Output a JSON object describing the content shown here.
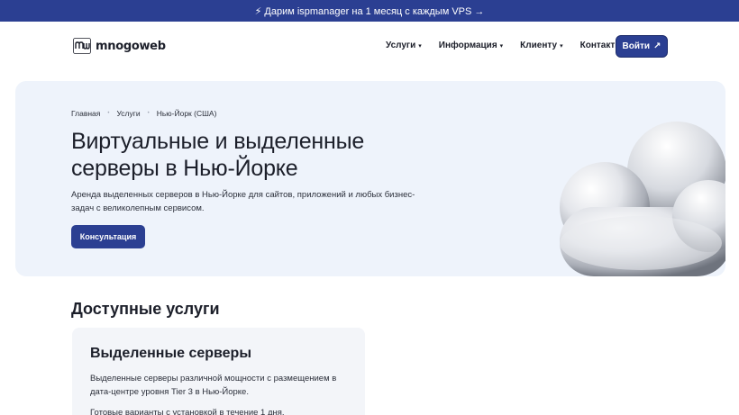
{
  "promo": {
    "text": "⚡ Дарим ispmanager на 1 месяц с каждым VPS →"
  },
  "header": {
    "logo_text": "mnogoweb",
    "nav": [
      {
        "label": "Услуги",
        "has_dropdown": true
      },
      {
        "label": "Информация",
        "has_dropdown": true
      },
      {
        "label": "Клиенту",
        "has_dropdown": true
      },
      {
        "label": "Контакты",
        "has_dropdown": false
      }
    ],
    "login_label": "Войти",
    "login_icon": "↗"
  },
  "hero": {
    "breadcrumb": [
      "Главная",
      "Услуги",
      "Нью-Йорк (США)"
    ],
    "breadcrumb_sep": "•",
    "title": "Виртуальные и выделенные серверы в Нью-Йорке",
    "description": "Аренда выделенных серверов в Нью-Йорке для сайтов, приложений и любых бизнес-задач с великолепным сервисом.",
    "cta_label": "Консультация"
  },
  "services": {
    "title": "Доступные услуги",
    "card": {
      "title": "Выделенные серверы",
      "description": "Выделенные серверы различной мощности с размещением в дата-центре уровня Tier 3 в Нью-Йорке.",
      "extra": "Готовые варианты с установкой в течение 1 дня."
    }
  },
  "colors": {
    "brand": "#2b3f92",
    "hero_bg": "#eef3fb",
    "card_bg": "#f3f5f9"
  }
}
